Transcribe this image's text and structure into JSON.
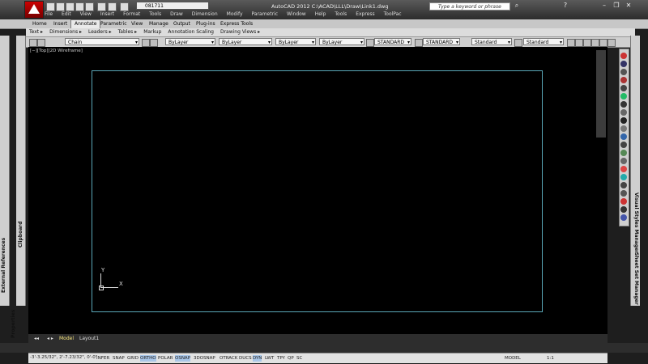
{
  "title_bar": {
    "app_title": "AutoCAD 2012   C:\\ACAD\\LLL\\Draw\\Link1.dwg",
    "workspace": "081711",
    "help_search_placeholder": "Type a keyword or phrase"
  },
  "menu": [
    "File",
    "Edit",
    "View",
    "Insert",
    "Format",
    "Tools",
    "Draw",
    "Dimension",
    "Modify",
    "Parametric",
    "Window",
    "Help",
    "Tools",
    "Express",
    "ToolPac"
  ],
  "ribbon_tabs": [
    "Home",
    "Insert",
    "Annotate",
    "Parametric",
    "View",
    "Manage",
    "Output",
    "Plug-ins",
    "Express Tools"
  ],
  "active_ribbon_tab": "Annotate",
  "ribbon_panels": [
    "Text ▸",
    "Dimensions ▸",
    "Leaders ▸",
    "Tables ▸",
    "Markup",
    "Annotation Scaling",
    "Drawing Views ▸"
  ],
  "properties_toolbar": {
    "layer": "Chain",
    "color": "ByLayer",
    "linetype": "ByLayer",
    "lineweight": "ByLayer",
    "plotstyle": "ByLayer",
    "text_style": "STANDARD",
    "dim_style": "STANDARD",
    "table_style": "Standard",
    "mleader_style": "Standard"
  },
  "viewport_label": "[−][Top][2D Wireframe]",
  "ucs": {
    "y": "Y",
    "x": "X"
  },
  "layout_tabs": [
    "Model",
    "Layout1"
  ],
  "active_layout": "Model",
  "status": {
    "coordinates": "-3'-3.25/32\", 2'-7.23/32\", 0'-0\"",
    "toggles": [
      "INFER",
      "SNAP",
      "GRID",
      "ORTHO",
      "POLAR",
      "OSNAP",
      "3DOSNAP",
      "OTRACK",
      "DUCS",
      "DYN",
      "LWT",
      "TPY",
      "QP",
      "SC"
    ],
    "active_toggles": [
      "ORTHO",
      "OSNAP",
      "DYN"
    ],
    "model_label": "MODEL",
    "scale": "1:1"
  },
  "side_palettes": {
    "left_outer": [
      "External References",
      "Properties"
    ],
    "left_inner": [
      "Clipboard"
    ],
    "right": [
      "Visual Styles Manager",
      "Sheet Set Manager"
    ]
  },
  "colors": {
    "drawing_bg": "#000000",
    "border": "#5aa7b8"
  }
}
